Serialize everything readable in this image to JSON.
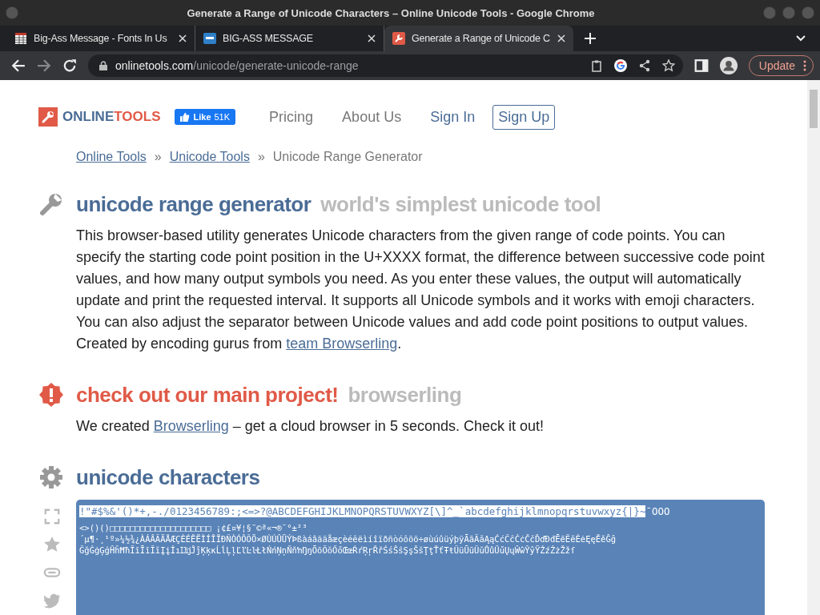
{
  "window": {
    "title": "Generate a Range of Unicode Characters – Online Unicode Tools - Google Chrome"
  },
  "tabs": [
    {
      "label": "Big-Ass Message - Fonts In Us",
      "selected": false
    },
    {
      "label": "BIG-ASS MESSAGE",
      "selected": false
    },
    {
      "label": "Generate a Range of Unicode C",
      "selected": true
    }
  ],
  "address_bar": {
    "host": "onlinetools.com",
    "path": "/unicode/generate-unicode-range",
    "update_button": "Update"
  },
  "header": {
    "logo_first": "ONLINE",
    "logo_second": "TOOLS",
    "like_button": {
      "label": "Like",
      "count": "51K"
    },
    "nav": [
      {
        "label": "Pricing",
        "kind": "link"
      },
      {
        "label": "About Us",
        "kind": "link"
      },
      {
        "label": "Sign In",
        "kind": "accent"
      },
      {
        "label": "Sign Up",
        "kind": "outlined"
      }
    ]
  },
  "breadcrumbs": [
    {
      "label": "Online Tools",
      "link": true
    },
    {
      "label": "Unicode Tools",
      "link": true
    },
    {
      "label": "Unicode Range Generator",
      "link": false
    }
  ],
  "breadcrumb_separator": "»",
  "sections": [
    {
      "title": "unicode range generator",
      "subtitle": "world's simplest unicode tool",
      "text": "This browser-based utility generates Unicode characters from the given range of code points. You can specify the starting code point position in the U+XXXX format, the difference between successive code point values, and how many output symbols you need. As you enter these values, the output will automatically update and print the requested interval. It supports all Unicode symbols and it works with emoji characters. You can also adjust the separator between Unicode values and add code point positions to output values. Created by encoding gurus from ",
      "link": "team Browserling",
      "after": "."
    },
    {
      "title": "check out our main project!",
      "subtitle": "browserling",
      "text": "We created ",
      "link": "Browserling",
      "after": " – get a cloud browser in 5 seconds. Check it out!"
    },
    {
      "title": "unicode characters"
    }
  ],
  "output": {
    "selected_text": "!\"#$%&'()*+,-./0123456789:;<=>?@ABCDEFGHIJKLMNOPQRSTUVWXYZ[\\]^_`abcdefghijklmnopqrstuvwxyz{|}~",
    "lines": [
      "ˉOOO",
      "<>()()□□□□□□□□□□□□□□□□□□□□ ¡¢£¤¥¦§¨©ª«¬®¯°±²³",
      "´µ¶·¸¹º»¼½¾¿ÀÁÂÃÄÅÆÇÈÉÊËÌÍÎÏÐÑÒÓÔÕÖ×ØÙÚÛÜÝÞßàáâãäåæçèéêëìíîïðñòóôõö÷øùúûüýþÿĀāĂăĄąĆćĈĉĊċČčĎďĐđĒēĔĕĖėĘęĚěĜĝ",
      "ĞğĠġĢģĤĥĦħĨĩĪīĬĭĮįİıĲĳĴĵĶķĸĹĺĻļĽľĿŀŁłŃńŅņŇňŉŊŋŌōŎŏŐőŒœŔŕŖŗŘřŚśŜŝŞşŠšŢţŤťŦŧŨũŪūŬŭŮůŰűŲųŴŵŶŷŸŹźŻżŽžſ"
    ]
  }
}
